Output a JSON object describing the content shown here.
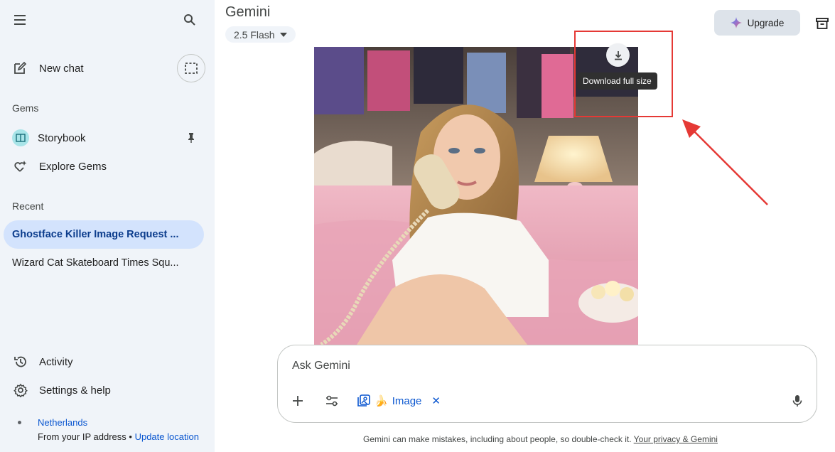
{
  "sidebar": {
    "new_chat_label": "New chat",
    "gems_heading": "Gems",
    "gems": [
      {
        "label": "Storybook",
        "icon": "book-icon"
      },
      {
        "label": "Explore Gems",
        "icon": "gem-sparkle-icon"
      }
    ],
    "recent_heading": "Recent",
    "recent": [
      {
        "label": "Ghostface Killer Image Request ...",
        "active": true
      },
      {
        "label": "Wizard Cat Skateboard Times Squ...",
        "active": false
      }
    ],
    "activity_label": "Activity",
    "settings_label": "Settings & help",
    "location": {
      "country": "Netherlands",
      "source": "From your IP address",
      "separator": "•",
      "update_link": "Update location"
    }
  },
  "header": {
    "title": "Gemini",
    "model": "2.5 Flash",
    "upgrade_label": "Upgrade"
  },
  "image": {
    "tooltip": "Download full size"
  },
  "composer": {
    "placeholder": "Ask Gemini",
    "tool_chip_label": "Image",
    "tool_chip_emoji": "🍌",
    "remove_symbol": "✕"
  },
  "footer": {
    "disclaimer": "Gemini can make mistakes, including about people, so double-check it.",
    "privacy_link": "Your privacy & Gemini"
  },
  "colors": {
    "sidebar_bg": "#f0f4f9",
    "active_item_bg": "#d3e3fd",
    "link_blue": "#0b57d0",
    "annotation_red": "#e53935"
  }
}
